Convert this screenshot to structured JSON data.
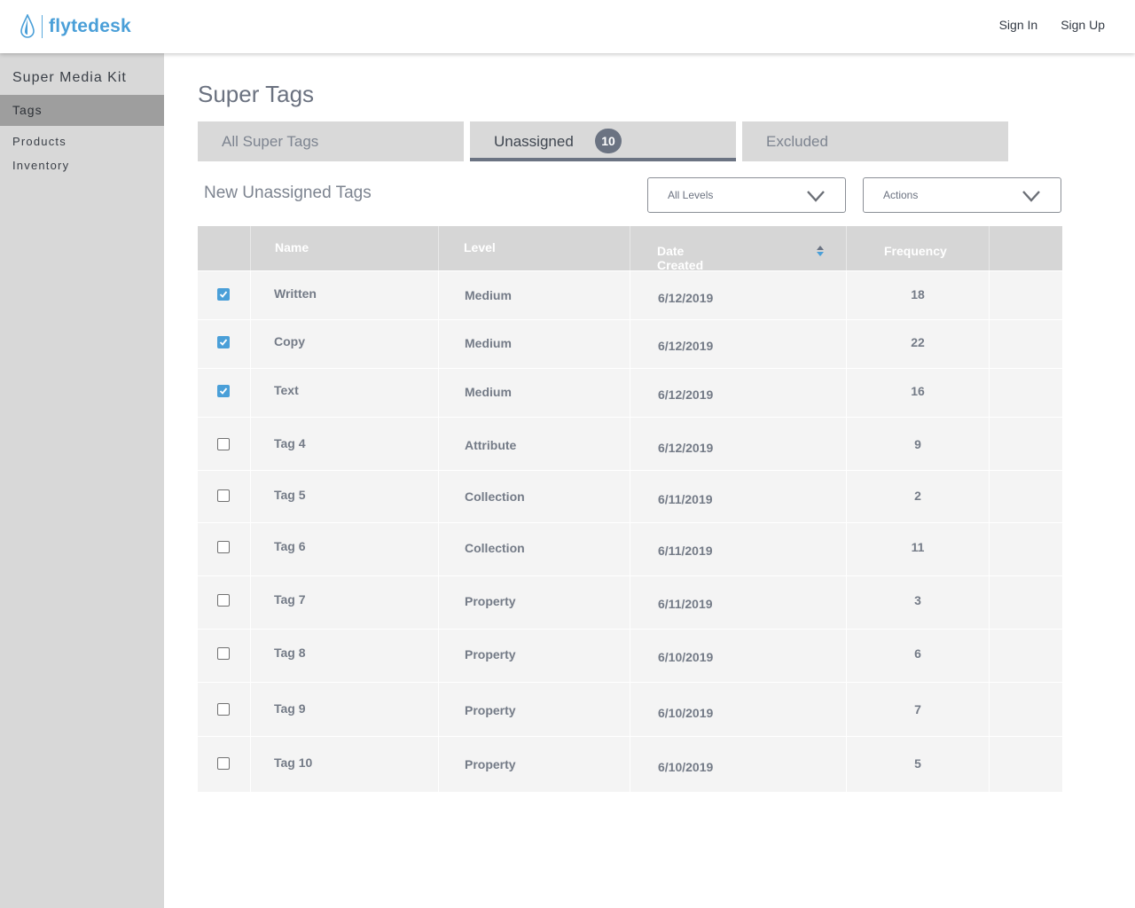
{
  "header": {
    "brand": "flytedesk",
    "sign_in": "Sign In",
    "sign_up": "Sign Up"
  },
  "sidebar": {
    "title": "Super Media Kit",
    "items": [
      {
        "label": "Tags",
        "active": true
      },
      {
        "label": "Products",
        "active": false
      },
      {
        "label": "Inventory",
        "active": false
      }
    ]
  },
  "main": {
    "title": "Super Tags",
    "tabs": [
      {
        "label": "All Super Tags",
        "badge": null,
        "active": false
      },
      {
        "label": "Unassigned",
        "badge": "10",
        "active": true
      },
      {
        "label": "Excluded",
        "badge": null,
        "active": false
      }
    ],
    "section_title": "New Unassigned Tags",
    "level_filter": {
      "selected": "All Levels"
    },
    "actions": {
      "selected": "Actions"
    }
  },
  "table": {
    "columns": [
      "Name",
      "Level",
      "Date Created",
      "Frequency"
    ],
    "sort_icon": "sort-up-down-icon",
    "rows": [
      {
        "checked": true,
        "name": "Written",
        "level": "Medium",
        "date": "6/12/2019",
        "frequency": "18"
      },
      {
        "checked": true,
        "name": "Copy",
        "level": "Medium",
        "date": "6/12/2019",
        "frequency": "22"
      },
      {
        "checked": true,
        "name": "Text",
        "level": "Medium",
        "date": "6/12/2019",
        "frequency": "16"
      },
      {
        "checked": false,
        "name": "Tag 4",
        "level": "Attribute",
        "date": "6/12/2019",
        "frequency": "9"
      },
      {
        "checked": false,
        "name": "Tag 5",
        "level": "Collection",
        "date": "6/11/2019",
        "frequency": "2"
      },
      {
        "checked": false,
        "name": "Tag 6",
        "level": "Collection",
        "date": "6/11/2019",
        "frequency": "11"
      },
      {
        "checked": false,
        "name": "Tag 7",
        "level": "Property",
        "date": "6/11/2019",
        "frequency": "3"
      },
      {
        "checked": false,
        "name": "Tag 8",
        "level": "Property",
        "date": "6/10/2019",
        "frequency": "6"
      },
      {
        "checked": false,
        "name": "Tag 9",
        "level": "Property",
        "date": "6/10/2019",
        "frequency": "7"
      },
      {
        "checked": false,
        "name": "Tag 10",
        "level": "Property",
        "date": "6/10/2019",
        "frequency": "5"
      }
    ]
  },
  "colors": {
    "brand": "#4a9fd8",
    "checkbox_checked": "#4a9fd8",
    "active_tab_underline": "#6b7382",
    "sidebar_bg": "#d8d8d8",
    "sidebar_active_bg": "#9e9e9e"
  }
}
